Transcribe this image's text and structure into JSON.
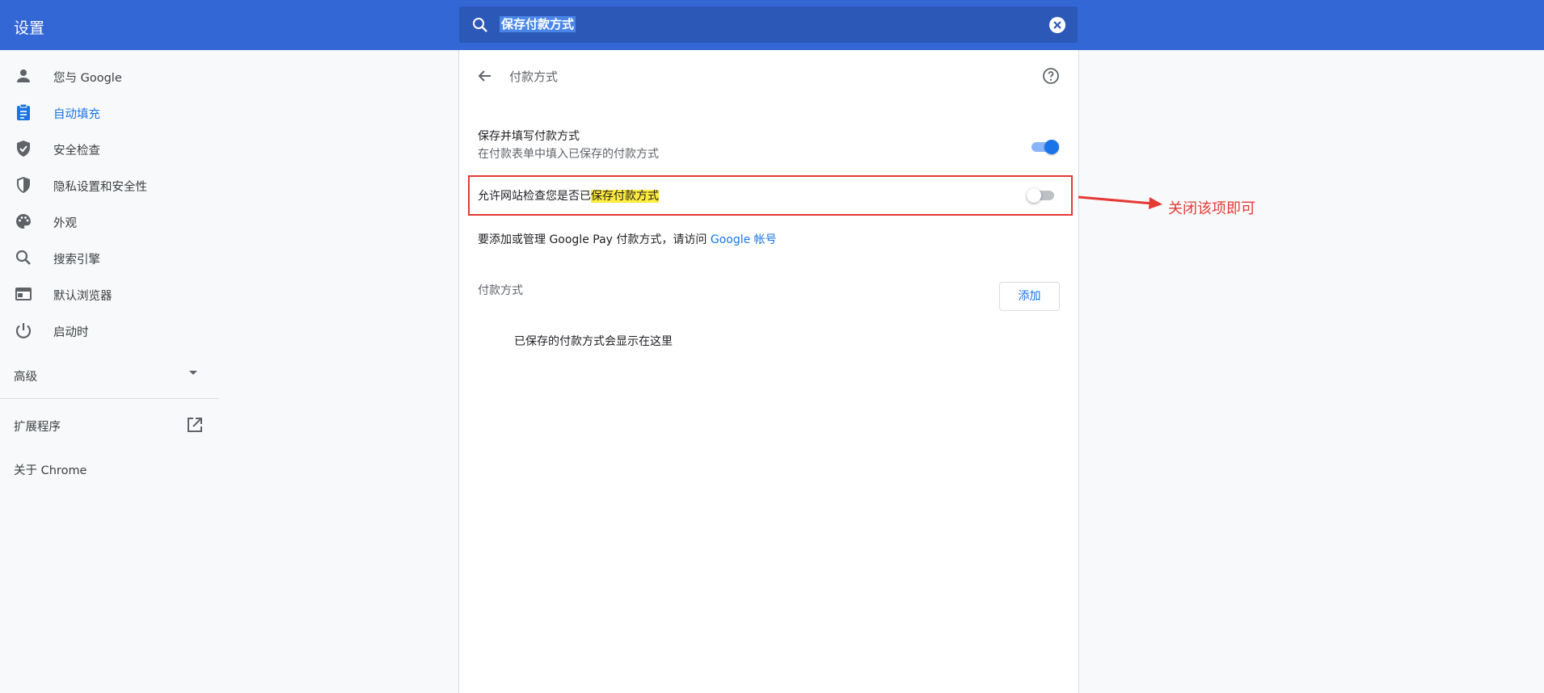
{
  "header": {
    "title": "设置",
    "search_value": "保存付款方式"
  },
  "sidebar": {
    "items": [
      {
        "label": "您与 Google",
        "icon": "person-icon"
      },
      {
        "label": "自动填充",
        "icon": "clipboard-icon",
        "active": true
      },
      {
        "label": "安全检查",
        "icon": "shield-check-icon"
      },
      {
        "label": "隐私设置和安全性",
        "icon": "shield-half-icon"
      },
      {
        "label": "外观",
        "icon": "palette-icon"
      },
      {
        "label": "搜索引擎",
        "icon": "search-icon"
      },
      {
        "label": "默认浏览器",
        "icon": "browser-icon"
      },
      {
        "label": "启动时",
        "icon": "power-icon"
      }
    ],
    "advanced": "高级",
    "extensions": "扩展程序",
    "about": "关于 Chrome"
  },
  "main": {
    "title": "付款方式",
    "save_fill_title": "保存并填写付款方式",
    "save_fill_desc": "在付款表单中填入已保存的付款方式",
    "save_fill_enabled": true,
    "allow_check_prefix": "允许网站检查您是否已",
    "allow_check_highlight": "保存付款方式",
    "allow_check_enabled": false,
    "gpay_text": "要添加或管理 Google Pay 付款方式，请访问 ",
    "gpay_link": "Google 帐号",
    "payment_methods_label": "付款方式",
    "add_button": "添加",
    "empty_text": "已保存的付款方式会显示在这里"
  },
  "annotation": {
    "text": "关闭该项即可",
    "color": "#e53935"
  },
  "colors": {
    "header": "#3367d6",
    "accent": "#1a73e8",
    "highlight": "#ffeb3b"
  }
}
